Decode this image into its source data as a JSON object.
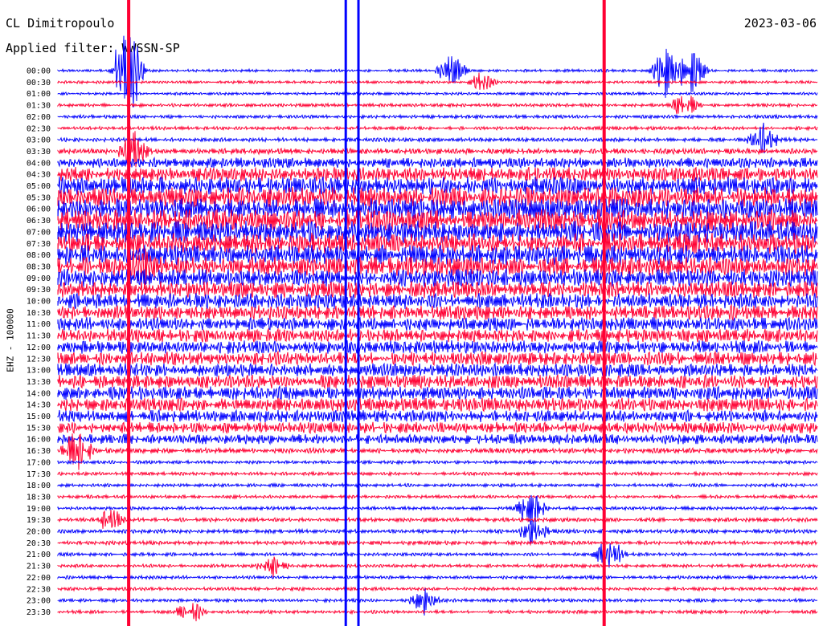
{
  "header": {
    "station": "CL Dimitropoulo",
    "date": "2023-03-06",
    "filter": "Applied filter: WWSSN-SP"
  },
  "chart_data": {
    "type": "line",
    "ylabel": "EHZ - 100000",
    "colors": [
      "#0000ff",
      "#ff0033"
    ],
    "row_labels": [
      "00:00",
      "00:30",
      "01:00",
      "01:30",
      "02:00",
      "02:30",
      "03:00",
      "03:30",
      "04:00",
      "04:30",
      "05:00",
      "05:30",
      "06:00",
      "06:30",
      "07:00",
      "07:30",
      "08:00",
      "08:30",
      "09:00",
      "09:30",
      "10:00",
      "10:30",
      "11:00",
      "11:30",
      "12:00",
      "12:30",
      "13:00",
      "13:30",
      "14:00",
      "14:30",
      "15:00",
      "15:30",
      "16:00",
      "16:30",
      "17:00",
      "17:30",
      "18:00",
      "18:30",
      "19:00",
      "19:30",
      "20:00",
      "20:30",
      "21:00",
      "21:30",
      "22:00",
      "22:30",
      "23:00",
      "23:30"
    ],
    "noise_amplitude": [
      0.25,
      0.25,
      0.25,
      0.3,
      0.3,
      0.3,
      0.35,
      0.5,
      0.9,
      1.3,
      1.6,
      1.8,
      1.9,
      2.0,
      2.0,
      1.9,
      1.8,
      1.7,
      1.6,
      1.5,
      1.4,
      1.3,
      1.2,
      1.2,
      1.2,
      1.2,
      1.2,
      1.2,
      1.2,
      1.2,
      1.1,
      1.0,
      0.9,
      0.45,
      0.3,
      0.3,
      0.3,
      0.3,
      0.3,
      0.35,
      0.35,
      0.35,
      0.3,
      0.3,
      0.3,
      0.3,
      0.3,
      0.3
    ],
    "events": [
      {
        "row": 0,
        "minute": 2.8,
        "amplitude": 8.0
      },
      {
        "row": 0,
        "minute": 24.1,
        "amplitude": 4.0
      },
      {
        "row": 0,
        "minute": 15.6,
        "amplitude": 2.5
      },
      {
        "row": 0,
        "minute": 25.0,
        "amplitude": 3.5
      },
      {
        "row": 1,
        "minute": 16.7,
        "amplitude": 1.5
      },
      {
        "row": 3,
        "minute": 24.8,
        "amplitude": 2.0
      },
      {
        "row": 6,
        "minute": 27.9,
        "amplitude": 2.5
      },
      {
        "row": 7,
        "minute": 3.0,
        "amplitude": 3.0
      },
      {
        "row": 17,
        "minute": 3.3,
        "amplitude": 4.0
      },
      {
        "row": 33,
        "minute": 0.8,
        "amplitude": 4.0
      },
      {
        "row": 38,
        "minute": 18.7,
        "amplitude": 2.5
      },
      {
        "row": 39,
        "minute": 2.0,
        "amplitude": 2.0
      },
      {
        "row": 40,
        "minute": 18.8,
        "amplitude": 2.0
      },
      {
        "row": 42,
        "minute": 21.8,
        "amplitude": 2.5
      },
      {
        "row": 43,
        "minute": 8.5,
        "amplitude": 1.8
      },
      {
        "row": 46,
        "minute": 14.5,
        "amplitude": 2.0
      },
      {
        "row": 47,
        "minute": 5.2,
        "amplitude": 2.0
      }
    ],
    "vertical_lines": [
      {
        "minute": 2.8,
        "color": "#ff0033"
      },
      {
        "minute": 11.4,
        "color": "#0000ff"
      },
      {
        "minute": 11.9,
        "color": "#0000ff"
      },
      {
        "minute": 21.6,
        "color": "#ff0033"
      }
    ]
  }
}
